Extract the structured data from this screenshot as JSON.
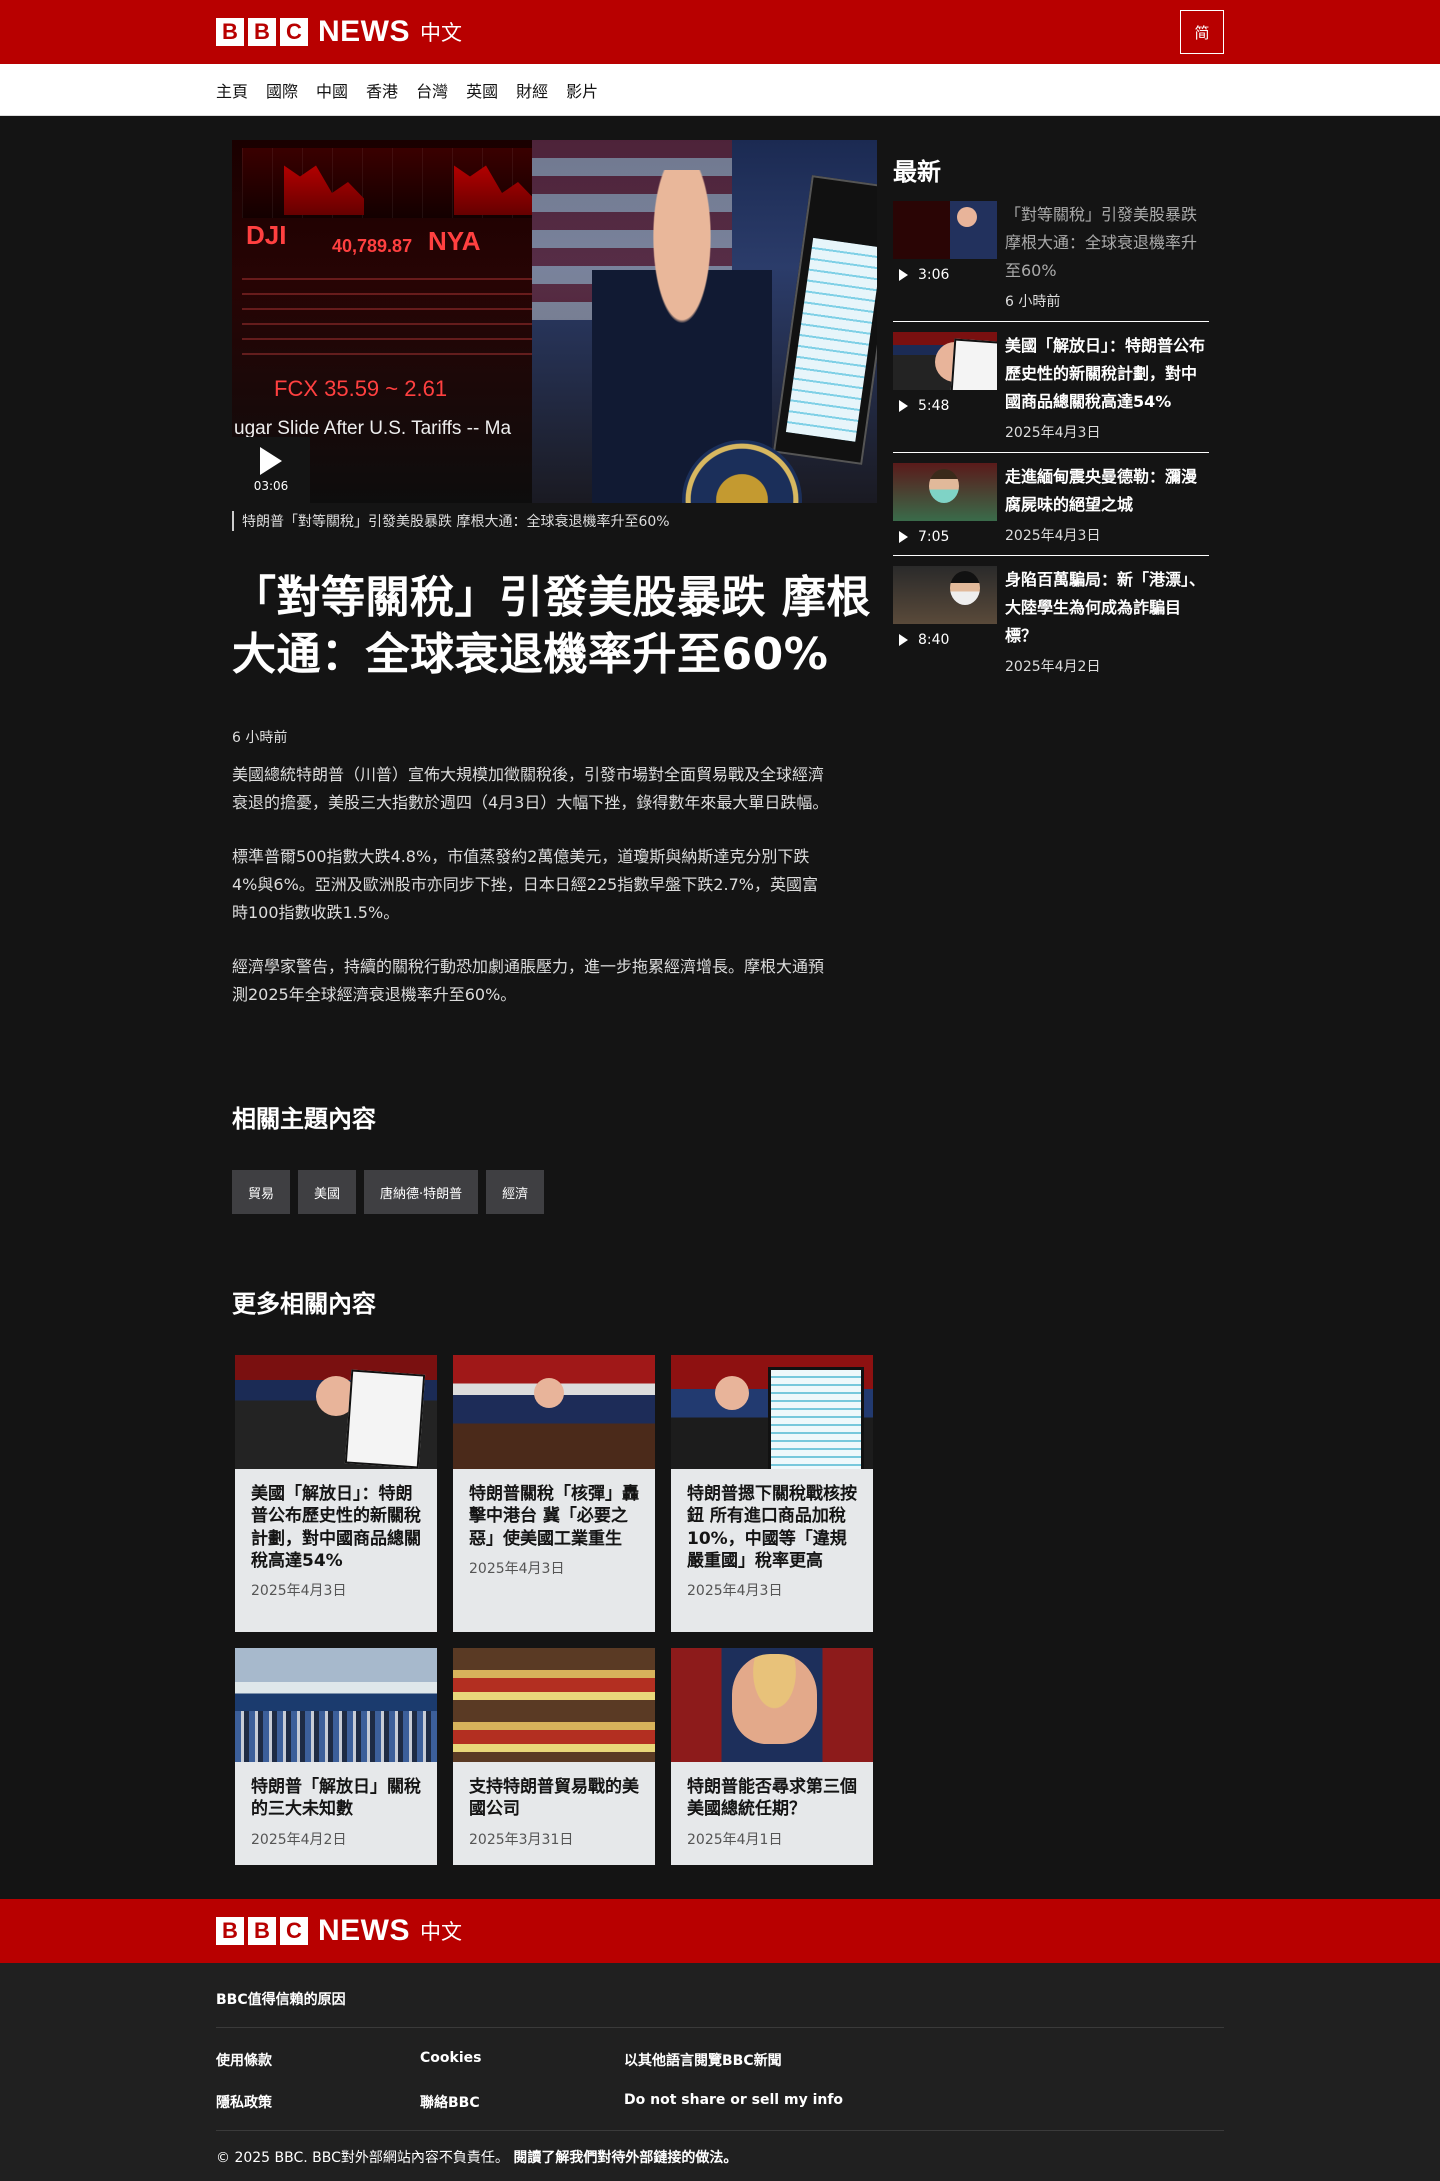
{
  "header": {
    "logo_letters": [
      "B",
      "B",
      "C"
    ],
    "logo_news": "NEWS",
    "logo_zh": "中文",
    "lang_toggle": "简"
  },
  "nav": {
    "items": [
      "主頁",
      "國際",
      "中國",
      "香港",
      "台灣",
      "英國",
      "財經",
      "影片"
    ]
  },
  "video": {
    "duration": "03:06",
    "overlay_texts": {
      "dji": "DJI",
      "dji_value": "40,789.87",
      "nya": "NYA",
      "fcx": "FCX 35.59 ~ 2.61",
      "crawl": "ugar Slide After U.S. Tariffs -- Ma"
    },
    "caption": "特朗普「對等關稅」引發美股暴跌 摩根大通：全球衰退機率升至60%"
  },
  "article": {
    "headline": "「對等關稅」引發美股暴跌 摩根大通：全球衰退機率升至60%",
    "date": "6 小時前",
    "paragraphs": [
      "美國總統特朗普（川普）宣佈大規模加徵關稅後，引發市場對全面貿易戰及全球經濟衰退的擔憂，美股三大指數於週四（4月3日）大幅下挫，錄得數年來最大單日跌幅。",
      "標準普爾500指數大跌4.8%，市值蒸發約2萬億美元，道瓊斯與納斯達克分別下跌4%與6%。亞洲及歐洲股市亦同步下挫，日本日經225指數早盤下跌2.7%，英國富時100指數收跌1.5%。",
      "經濟學家警告，持續的關稅行動恐加劇通脹壓力，進一步拖累經濟增長。摩根大通預測2025年全球經濟衰退機率升至60%。"
    ]
  },
  "topics": {
    "title": "相關主題內容",
    "tags": [
      "貿易",
      "美國",
      "唐納德·特朗普",
      "經濟"
    ]
  },
  "more": {
    "title": "更多相關內容",
    "cards": [
      {
        "title": "美國「解放日」：特朗普公布歷史性的新關稅計劃，對中國商品總關稅高達54%",
        "date": "2025年4月3日"
      },
      {
        "title": "特朗普關稅「核彈」轟擊中港台 冀「必要之惡」使美國工業重生",
        "date": "2025年4月3日"
      },
      {
        "title": "特朗普摁下關稅戰核按鈕 所有進口商品加稅10%，中國等「違規嚴重國」稅率更高",
        "date": "2025年4月3日"
      },
      {
        "title": "特朗普「解放日」關稅的三大未知數",
        "date": "2025年4月2日"
      },
      {
        "title": "支持特朗普貿易戰的美國公司",
        "date": "2025年3月31日"
      },
      {
        "title": "特朗普能否尋求第三個美國總統任期？",
        "date": "2025年4月1日"
      }
    ]
  },
  "sidebar": {
    "title": "最新",
    "items": [
      {
        "title": "「對等關稅」引發美股暴跌 摩根大通：全球衰退機率升至60%",
        "duration": "3:06",
        "date": "6 小時前"
      },
      {
        "title": "美國「解放日」：特朗普公布歷史性的新關稅計劃，對中國商品總關稅高達54%",
        "duration": "5:48",
        "date": "2025年4月3日"
      },
      {
        "title": "走進緬甸震央曼德勒：瀰漫腐屍味的絕望之城",
        "duration": "7:05",
        "date": "2025年4月3日"
      },
      {
        "title": "身陷百萬騙局：新「港漂」、大陸學生為何成為詐騙目標？",
        "duration": "8:40",
        "date": "2025年4月2日"
      }
    ]
  },
  "footer": {
    "why": "BBC值得信賴的原因",
    "links": [
      "使用條款",
      "Cookies",
      "以其他語言閱覽BBC新聞",
      "隱私政策",
      "聯絡BBC",
      "Do not share or sell my info"
    ],
    "copyright": "© 2025 BBC. BBC對外部網站內容不負責任。",
    "external_link": "閱讀了解我們對待外部鏈接的做法。"
  },
  "colors": {
    "brand_red": "#b80000",
    "page_bg": "#141414",
    "card_bg": "#e6e8ea",
    "tag_bg": "#3f3f42",
    "footer_bg": "#202020"
  }
}
